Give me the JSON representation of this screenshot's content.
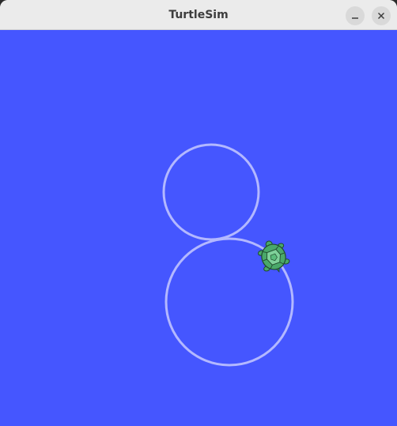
{
  "window": {
    "title": "TurtleSim",
    "buttons": {
      "minimize_icon": "minimize-icon",
      "close_icon": "close-icon"
    }
  },
  "canvas": {
    "background_color": "#4556ff",
    "pen_color": "#b3b8ff"
  },
  "turtle": {
    "shell_color": "#4aa86a",
    "outline_color": "#1f4a2c"
  }
}
